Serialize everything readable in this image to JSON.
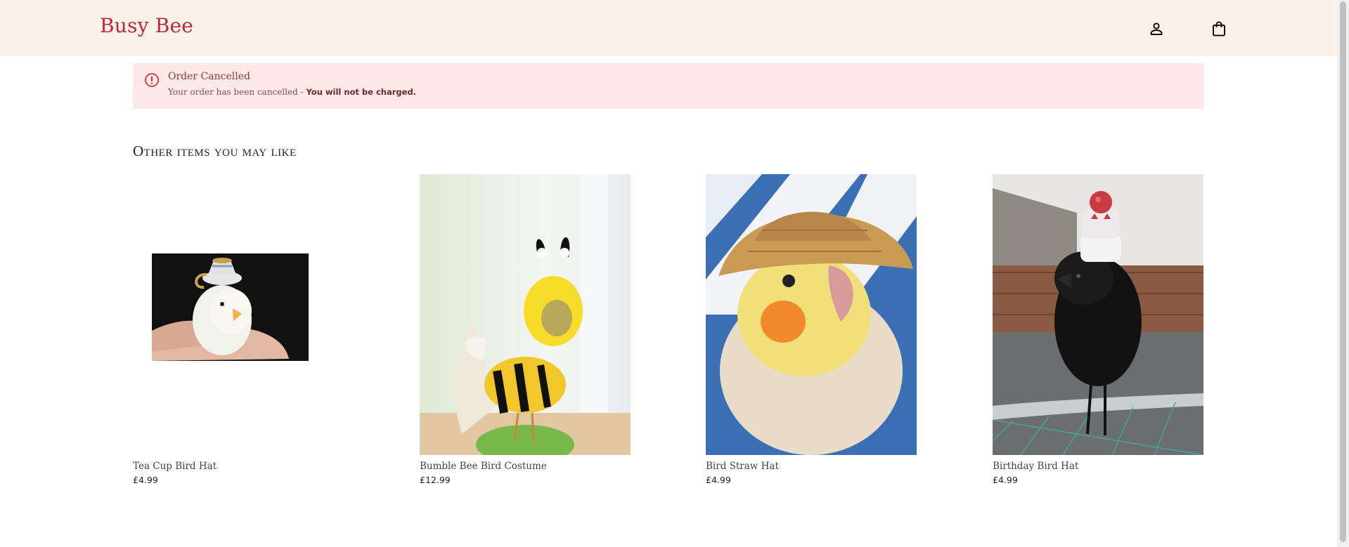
{
  "header": {
    "brand": "Busy Bee",
    "account_icon": "person-icon",
    "bag_icon": "shopping-bag-icon",
    "background_color": "#faf2e8",
    "brand_color": "#c0263d"
  },
  "alert": {
    "icon": "alert-circle-icon",
    "title": "Order Cancelled",
    "message": "Your order has been cancelled - ",
    "message_strong": "You will not be charged.",
    "background_color": "#fde8e8"
  },
  "recommendations": {
    "title": "Other items you may like",
    "products": [
      {
        "name": "Tea Cup Bird Hat",
        "price": "£4.99"
      },
      {
        "name": "Bumble Bee Bird Costume",
        "price": "£12.99"
      },
      {
        "name": "Bird Straw Hat",
        "price": "£4.99"
      },
      {
        "name": "Birthday Bird Hat",
        "price": "£4.99"
      }
    ]
  }
}
